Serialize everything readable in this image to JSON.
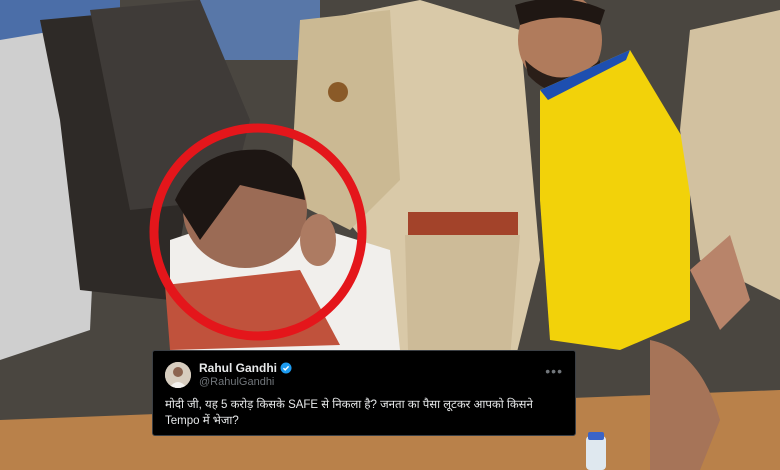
{
  "tweet": {
    "display_name": "Rahul Gandhi",
    "handle": "@RahulGandhi",
    "text": "मोदी जी, यह 5 करोड़ किसके SAFE से निकला है? जनता का पैसा लूटकर आपको किसने Tempo में भेजा?",
    "verified_icon": "verified-badge",
    "more_icon": "more-options"
  },
  "photo": {
    "highlight_color": "#e4161b"
  },
  "colors": {
    "card_bg": "#000000",
    "verified_blue": "#1d9bf0",
    "handle_gray": "#71767b"
  }
}
